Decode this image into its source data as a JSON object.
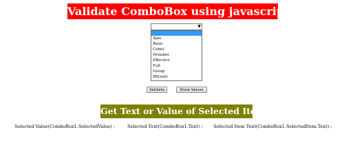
{
  "header": {
    "title": "Validate ComboBox using javascript"
  },
  "combobox": {
    "selected_value": "",
    "arrow_icon": "dropdown-arrow-icon"
  },
  "listbox": {
    "items": [
      "Ajax",
      "Basic",
      "Cobol",
      "Dynamic",
      "Effective",
      "Full",
      "Group",
      "Ifficient"
    ]
  },
  "buttons": {
    "validate_label": "Validate",
    "show_values_label": "Show Values"
  },
  "section": {
    "title": "Get Text or Value of Selected Item."
  },
  "results": {
    "selected_value_label": "Selected Value(ComboBox1.SelectedValue) :",
    "selected_text_label": "Selected Text(ComboBox1.Text) :",
    "selected_item_text_label": "Selected Item Text(ComboBox1.SelectedItem.Text) :"
  },
  "colors": {
    "title_bg": "#ff0000",
    "section_bg": "#808000",
    "selection_bg": "#3399ff"
  }
}
